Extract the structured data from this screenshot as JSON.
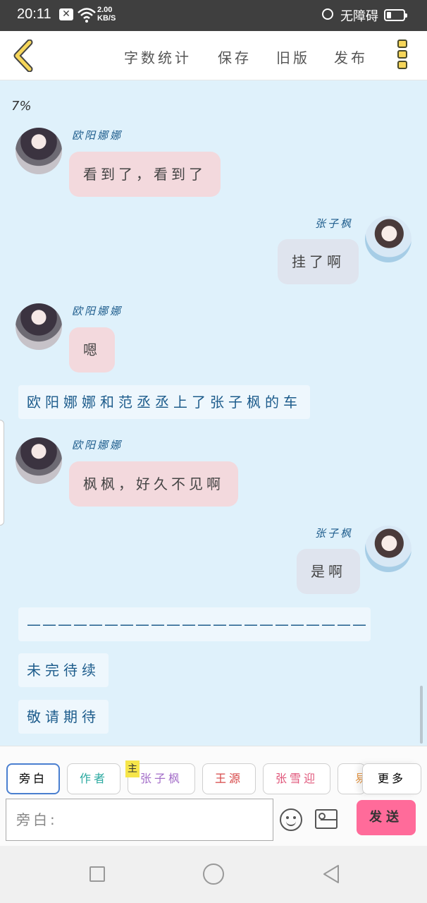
{
  "status_bar": {
    "time": "20:11",
    "x_badge": "✕",
    "net_speed_top": "2.00",
    "net_speed_bottom": "KB/S",
    "accessibility": "无障碍"
  },
  "toolbar": {
    "word_count": "字数统计",
    "save": "保存",
    "old_version": "旧版",
    "publish": "发布"
  },
  "progress_label": "7%",
  "messages": [
    {
      "kind": "left",
      "name": "欧阳娜娜",
      "text": "看到了，看到了"
    },
    {
      "kind": "right",
      "name": "张子枫",
      "text": "挂了啊"
    },
    {
      "kind": "left",
      "name": "欧阳娜娜",
      "text": "嗯"
    },
    {
      "kind": "narration",
      "text": "欧阳娜娜和范丞丞上了张子枫的车"
    },
    {
      "kind": "left",
      "name": "欧阳娜娜",
      "text": "枫枫，好久不见啊"
    },
    {
      "kind": "right",
      "name": "张子枫",
      "text": "是啊"
    },
    {
      "kind": "narration",
      "text": "——————————————————————"
    },
    {
      "kind": "narration",
      "text": "未完待续"
    },
    {
      "kind": "narration",
      "text": "敬请期待"
    }
  ],
  "roles": [
    {
      "label": "旁白",
      "color": "#333333"
    },
    {
      "label": "作者",
      "color": "#2aa9a0"
    },
    {
      "label": "张子枫",
      "color": "#a46fc9",
      "tag": "主"
    },
    {
      "label": "王源",
      "color": "#d64545"
    },
    {
      "label": "张雪迎",
      "color": "#e0567a"
    },
    {
      "label": "易",
      "color": "#e89a4a"
    },
    {
      "label": "更多",
      "color": "#333333"
    }
  ],
  "composer": {
    "placeholder": "旁白:",
    "send_label": "发送"
  }
}
